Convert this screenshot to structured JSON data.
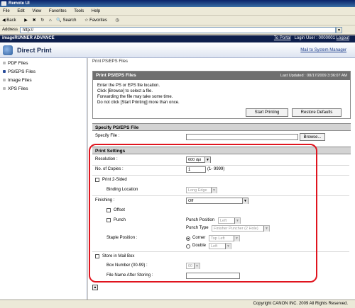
{
  "window": {
    "title": "Remote UI"
  },
  "menu": [
    "File",
    "Edit",
    "View",
    "Favorites",
    "Tools",
    "Help"
  ],
  "toolbar": {
    "back": "Back",
    "search": "Search",
    "favorites": "Favorites"
  },
  "address": {
    "label": "Address",
    "value": "http://"
  },
  "app": {
    "brand": "imageRUNNER ADVANCE",
    "to_portal": "To Portal",
    "login_user": "Login User : 0000001",
    "logout": "Logout",
    "title": "Direct Print",
    "mail_btn": "Mail to System Manager"
  },
  "sidebar": {
    "items": [
      {
        "label": "PDF Files"
      },
      {
        "label": "PS/EPS Files"
      },
      {
        "label": "Image Files"
      },
      {
        "label": "XPS Files"
      }
    ]
  },
  "main": {
    "crumb": "Print PS/EPS Files",
    "header": "Print PS/EPS Files",
    "last_updated": "Last Updated : 08/17/2009 3:36:07 AM",
    "instructions": [
      "Enter the PS or EPS file location.",
      "Click [Browse] to select a file.",
      "Forwarding the file may take some time.",
      "Do not click [Start Printing] more than once."
    ],
    "start_printing": "Start Printing",
    "restore_defaults": "Restore Defaults",
    "specify_section": "Specify PS/EPS File",
    "specify_label": "Specify File :",
    "browse": "Browse...",
    "settings_section": "Print Settings",
    "resolution_label": "Resolution :",
    "resolution_value": "600 dpi",
    "copies_label": "No. of Copies :",
    "copies_value": "1",
    "copies_range": "(1- 9999)",
    "print2sided_label": "Print 2-Sided",
    "binding_label": "Binding Location",
    "binding_value": "Long Edge",
    "finishing_label": "Finishing :",
    "finishing_value": "Off",
    "offset_label": "Offset",
    "punch_label": "Punch",
    "punch_position_label": "Punch Position",
    "punch_position_value": "Left",
    "punch_type_label": "Punch Type",
    "punch_type_value": "Finisher Puncher (2 Hole)",
    "staple_label": "Staple Position :",
    "corner_label": "Corner",
    "corner_value": "Top Left",
    "double_label": "Double",
    "double_value": "Left",
    "store_label": "Store in Mail Box",
    "box_number_label": "Box Number (00-99) :",
    "box_number_value": "00",
    "file_name_label": "File Name After Storing :"
  },
  "status": {
    "copyright": "Copyright CANON INC. 2009 All Rights Reserved."
  }
}
